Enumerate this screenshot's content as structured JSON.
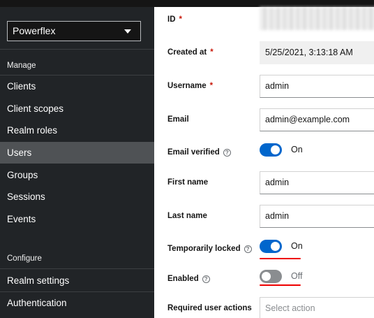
{
  "sidebar": {
    "realm_name": "Powerflex",
    "manage_heading": "Manage",
    "configure_heading": "Configure",
    "items": [
      {
        "label": "Clients"
      },
      {
        "label": "Client scopes"
      },
      {
        "label": "Realm roles"
      },
      {
        "label": "Users",
        "active": true
      },
      {
        "label": "Groups"
      },
      {
        "label": "Sessions"
      },
      {
        "label": "Events"
      }
    ],
    "configure_items": [
      {
        "label": "Realm settings"
      },
      {
        "label": "Authentication"
      }
    ]
  },
  "form": {
    "id": {
      "label": "ID",
      "required_mark": "*"
    },
    "created_at": {
      "label": "Created at",
      "required_mark": "*",
      "value": "5/25/2021, 3:13:18 AM"
    },
    "username": {
      "label": "Username",
      "required_mark": "*",
      "value": "admin"
    },
    "email": {
      "label": "Email",
      "value": "admin@example.com"
    },
    "email_verified": {
      "label": "Email verified",
      "state": "On",
      "on": true
    },
    "first_name": {
      "label": "First name",
      "value": "admin"
    },
    "last_name": {
      "label": "Last name",
      "value": "admin"
    },
    "temporarily_locked": {
      "label": "Temporarily locked",
      "state": "On",
      "on": true
    },
    "enabled": {
      "label": "Enabled",
      "state": "Off",
      "on": false
    },
    "required_actions": {
      "label": "Required user actions",
      "placeholder": "Select action"
    }
  },
  "colors": {
    "sidebar_bg": "#212427",
    "active_item_bg": "#4f5255",
    "switch_on": "#0066cc",
    "switch_off": "#8a8d90",
    "required_asterisk": "#c9190b",
    "annotation_underline": "#ee0000"
  }
}
